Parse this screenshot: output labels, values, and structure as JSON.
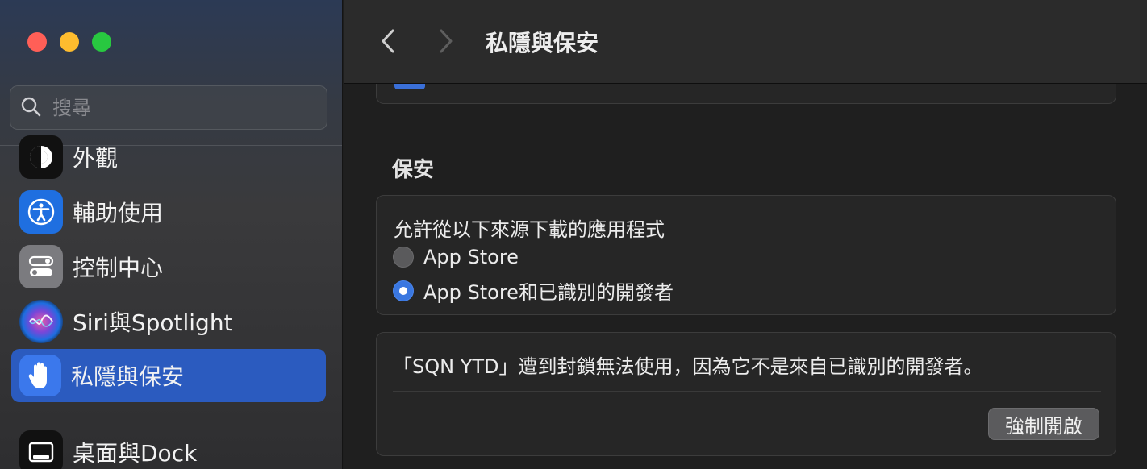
{
  "window": {
    "traffic_lights": [
      "close",
      "minimize",
      "zoom"
    ]
  },
  "sidebar": {
    "search": {
      "placeholder": "搜尋",
      "value": ""
    },
    "items": [
      {
        "label": "外觀",
        "icon": "appearance-icon",
        "icon_bg": "#111111"
      },
      {
        "label": "輔助使用",
        "icon": "accessibility-icon",
        "icon_bg": "#1f6fe0"
      },
      {
        "label": "控制中心",
        "icon": "control-center-icon",
        "icon_bg": "#7b7b7f"
      },
      {
        "label": "Siri與Spotlight",
        "icon": "siri-icon",
        "icon_bg": "#1a1a2e"
      },
      {
        "label": "私隱與保安",
        "icon": "hand-icon",
        "icon_bg": "#2f6fe6",
        "selected": true
      },
      {
        "label": "桌面與Dock",
        "icon": "dock-icon",
        "icon_bg": "#111111"
      }
    ]
  },
  "toolbar": {
    "title": "私隱與保安"
  },
  "security": {
    "section_title": "保安",
    "sources_heading": "允許從以下來源下載的應用程式",
    "options": [
      {
        "label": "App Store",
        "selected": false
      },
      {
        "label": "App Store和已識別的開發者",
        "selected": true
      }
    ],
    "block_message": "「SQN YTD」遭到封鎖無法使用，因為它不是來自已識別的開發者。",
    "open_anyway_label": "強制開啟"
  },
  "colors": {
    "accent": "#2b5bbf",
    "radio_on": "#3a77e0"
  }
}
